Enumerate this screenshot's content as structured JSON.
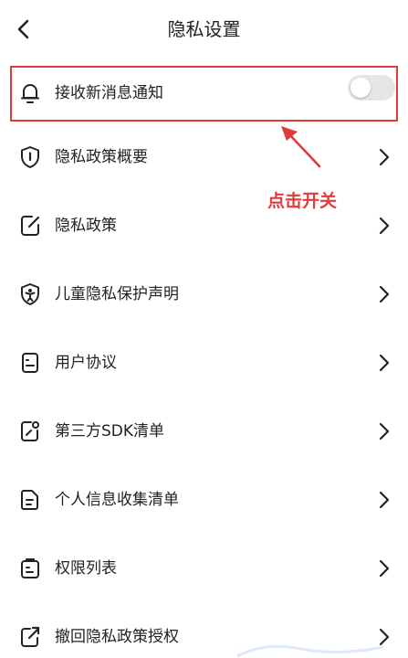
{
  "header": {
    "title": "隐私设置",
    "back_icon": "chevron-left-icon"
  },
  "notification": {
    "label": "接收新消息通知",
    "icon": "bell-icon",
    "toggle_on": false
  },
  "annotation": {
    "text": "点击开关",
    "color": "#e03a3a"
  },
  "items": [
    {
      "label": "隐私政策概要",
      "icon": "shield-info-icon"
    },
    {
      "label": "隐私政策",
      "icon": "edit-document-icon"
    },
    {
      "label": "儿童隐私保护声明",
      "icon": "child-shield-icon"
    },
    {
      "label": "用户协议",
      "icon": "agreement-icon"
    },
    {
      "label": "第三方SDK清单",
      "icon": "sdk-list-icon"
    },
    {
      "label": "个人信息收集清单",
      "icon": "document-list-icon"
    },
    {
      "label": "权限列表",
      "icon": "permission-list-icon"
    },
    {
      "label": "撤回隐私政策授权",
      "icon": "share-out-icon"
    }
  ]
}
